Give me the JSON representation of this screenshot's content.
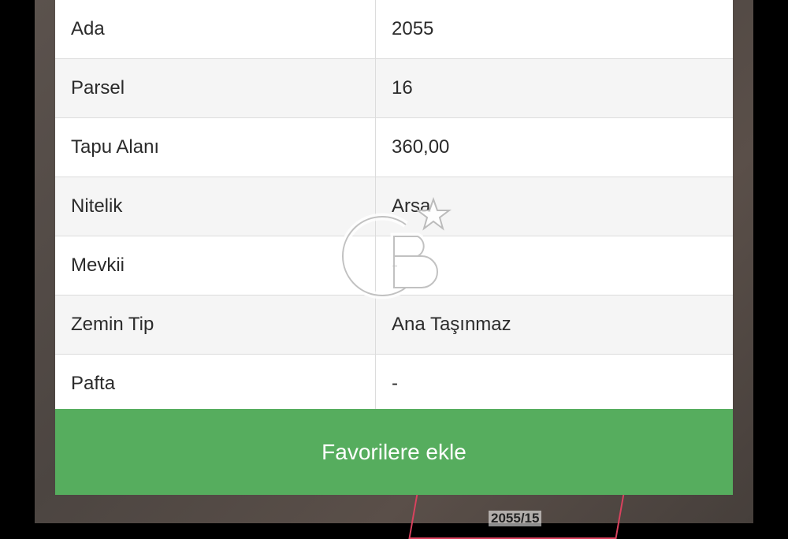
{
  "map": {
    "watermark_text": "sahibinden",
    "parcel_label": "2055/15"
  },
  "details": {
    "rows": [
      {
        "key": "Ada",
        "value": "2055"
      },
      {
        "key": "Parsel",
        "value": "16"
      },
      {
        "key": "Tapu Alanı",
        "value": "360,00"
      },
      {
        "key": "Nitelik",
        "value": "Arsa"
      },
      {
        "key": "Mevkii",
        "value": "-"
      },
      {
        "key": "Zemin Tip",
        "value": "Ana Taşınmaz"
      },
      {
        "key": "Pafta",
        "value": "-"
      }
    ]
  },
  "favorite_button": {
    "label": "Favorilere ekle"
  },
  "colors": {
    "accent": "#56ad5e",
    "parcel": "#d9425e"
  }
}
